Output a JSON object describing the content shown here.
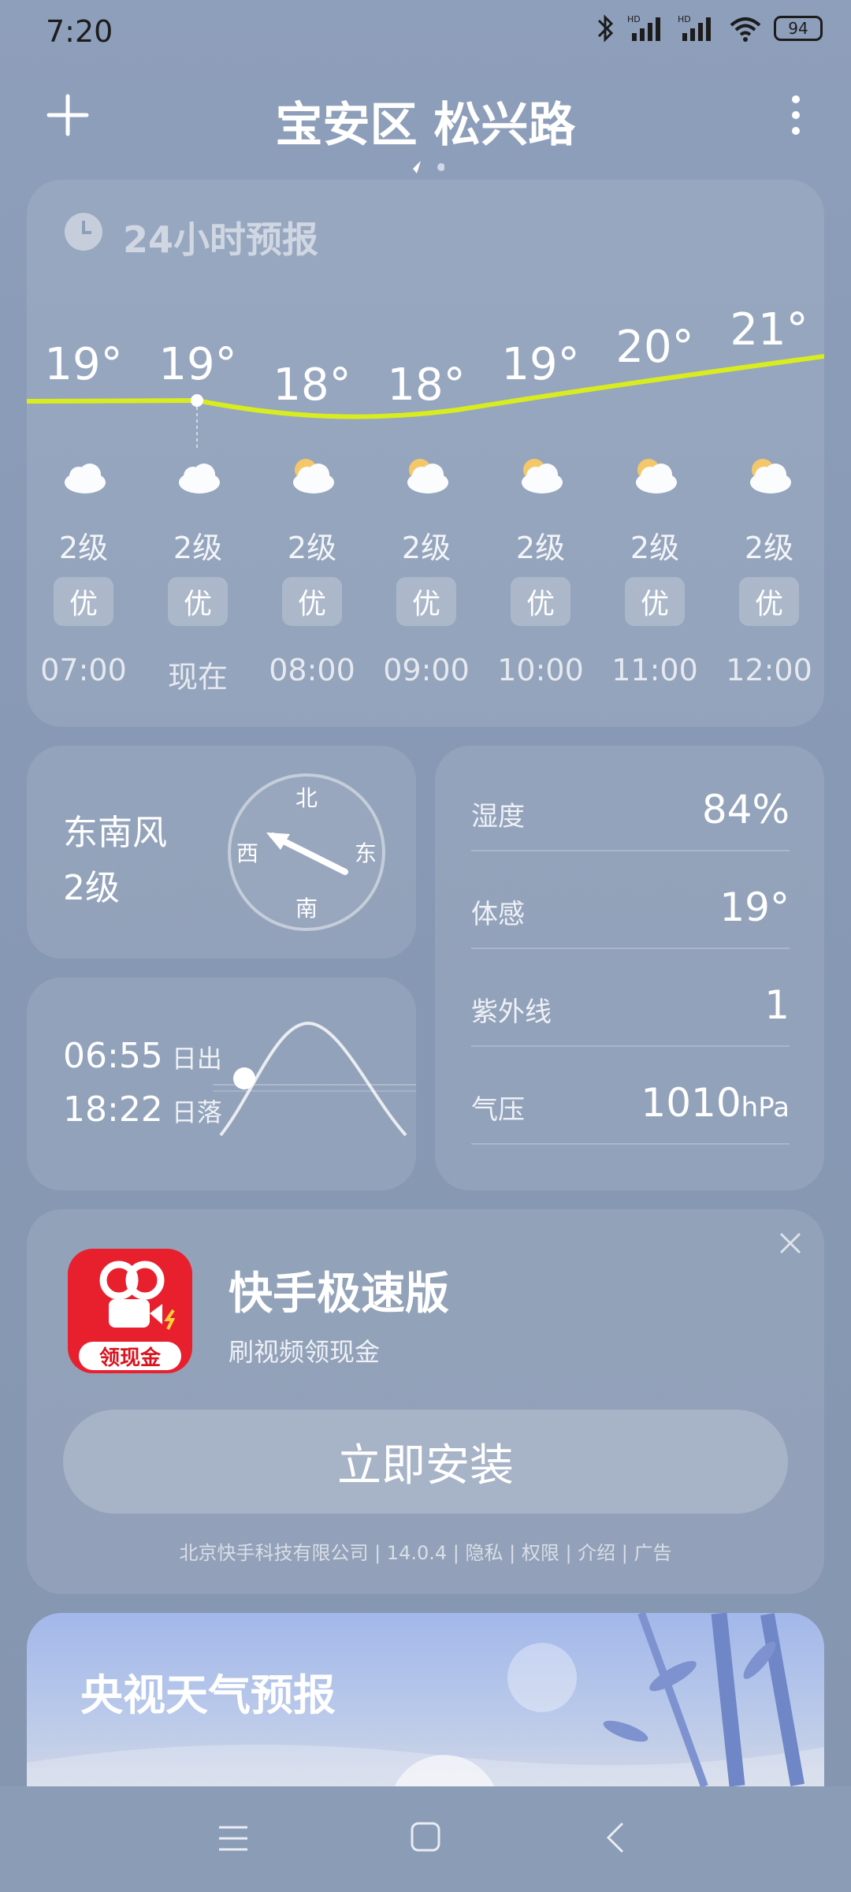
{
  "status_bar": {
    "time": "7:20",
    "battery": "94"
  },
  "header": {
    "title": "宝安区 松兴路"
  },
  "hourly": {
    "title": "24小时预报",
    "items": [
      {
        "temp": "19°",
        "wind": "2级",
        "aqi": "优",
        "time": "07:00",
        "icon": "cloudy-icon"
      },
      {
        "temp": "19°",
        "wind": "2级",
        "aqi": "优",
        "time": "现在",
        "icon": "cloudy-icon"
      },
      {
        "temp": "18°",
        "wind": "2级",
        "aqi": "优",
        "time": "08:00",
        "icon": "partly-cloudy-icon"
      },
      {
        "temp": "18°",
        "wind": "2级",
        "aqi": "优",
        "time": "09:00",
        "icon": "partly-cloudy-icon"
      },
      {
        "temp": "19°",
        "wind": "2级",
        "aqi": "优",
        "time": "10:00",
        "icon": "partly-cloudy-icon"
      },
      {
        "temp": "20°",
        "wind": "2级",
        "aqi": "优",
        "time": "11:00",
        "icon": "partly-cloudy-icon"
      },
      {
        "temp": "21°",
        "wind": "2级",
        "aqi": "优",
        "time": "12:00",
        "icon": "partly-cloudy-icon"
      }
    ]
  },
  "wind": {
    "direction": "东南风",
    "level": "2级",
    "compass": {
      "n": "北",
      "s": "南",
      "e": "东",
      "w": "西"
    }
  },
  "sun": {
    "sunrise": "06:55",
    "sunrise_label": "日出",
    "sunset": "18:22",
    "sunset_label": "日落"
  },
  "details": [
    {
      "label": "湿度",
      "value": "84%",
      "unit": ""
    },
    {
      "label": "体感",
      "value": "19°",
      "unit": ""
    },
    {
      "label": "紫外线",
      "value": "1",
      "unit": ""
    },
    {
      "label": "气压",
      "value": "1010",
      "unit": "hPa"
    }
  ],
  "ad": {
    "app_name": "快手极速版",
    "subtitle": "刷视频领现金",
    "icon_badge": "领现金",
    "install_label": "立即安装",
    "meta": "北京快手科技有限公司 | 14.0.4 | 隐私 | 权限 | 介绍 | 广告"
  },
  "cctv": {
    "title": "央视天气预报"
  },
  "colors": {
    "temp_line": "#d9ec1f",
    "ad_icon_red": "#e8202e"
  }
}
